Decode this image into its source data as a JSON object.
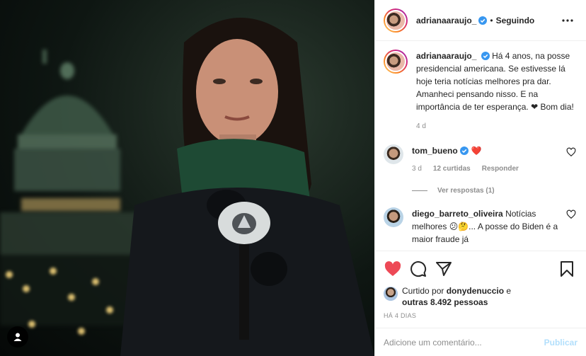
{
  "post": {
    "author": "adrianaaraujo_",
    "follow_status": "Seguindo",
    "caption": "Há 4 anos, na posse presidencial americana. Se estivesse lá hoje teria notícias melhores pra dar. Amanheci pensando nisso. E na importância de ter esperança. ❤ Bom dia!",
    "caption_time": "4 d"
  },
  "comments": [
    {
      "user": "tom_bueno",
      "text": "❤️",
      "time": "3 d",
      "likes": "12 curtidas",
      "reply_label": "Responder",
      "view_replies": "Ver respostas (1)"
    },
    {
      "user": "diego_barreto_oliveira",
      "text": "Notícias melhores 😕🤔... A posse do Biden é a maior fraude já"
    }
  ],
  "likes": {
    "prefix": "Curtido por",
    "user": "donydenuccio",
    "connector": "e",
    "others": "outras 8.492 pessoas"
  },
  "date": "HÁ 4 DIAS",
  "add_comment": {
    "placeholder": "Adicione um comentário...",
    "publish": "Publicar"
  },
  "colors": {
    "heart": "#ed4956",
    "verified": "#3897f0",
    "publish_disabled": "#b2dffc"
  }
}
